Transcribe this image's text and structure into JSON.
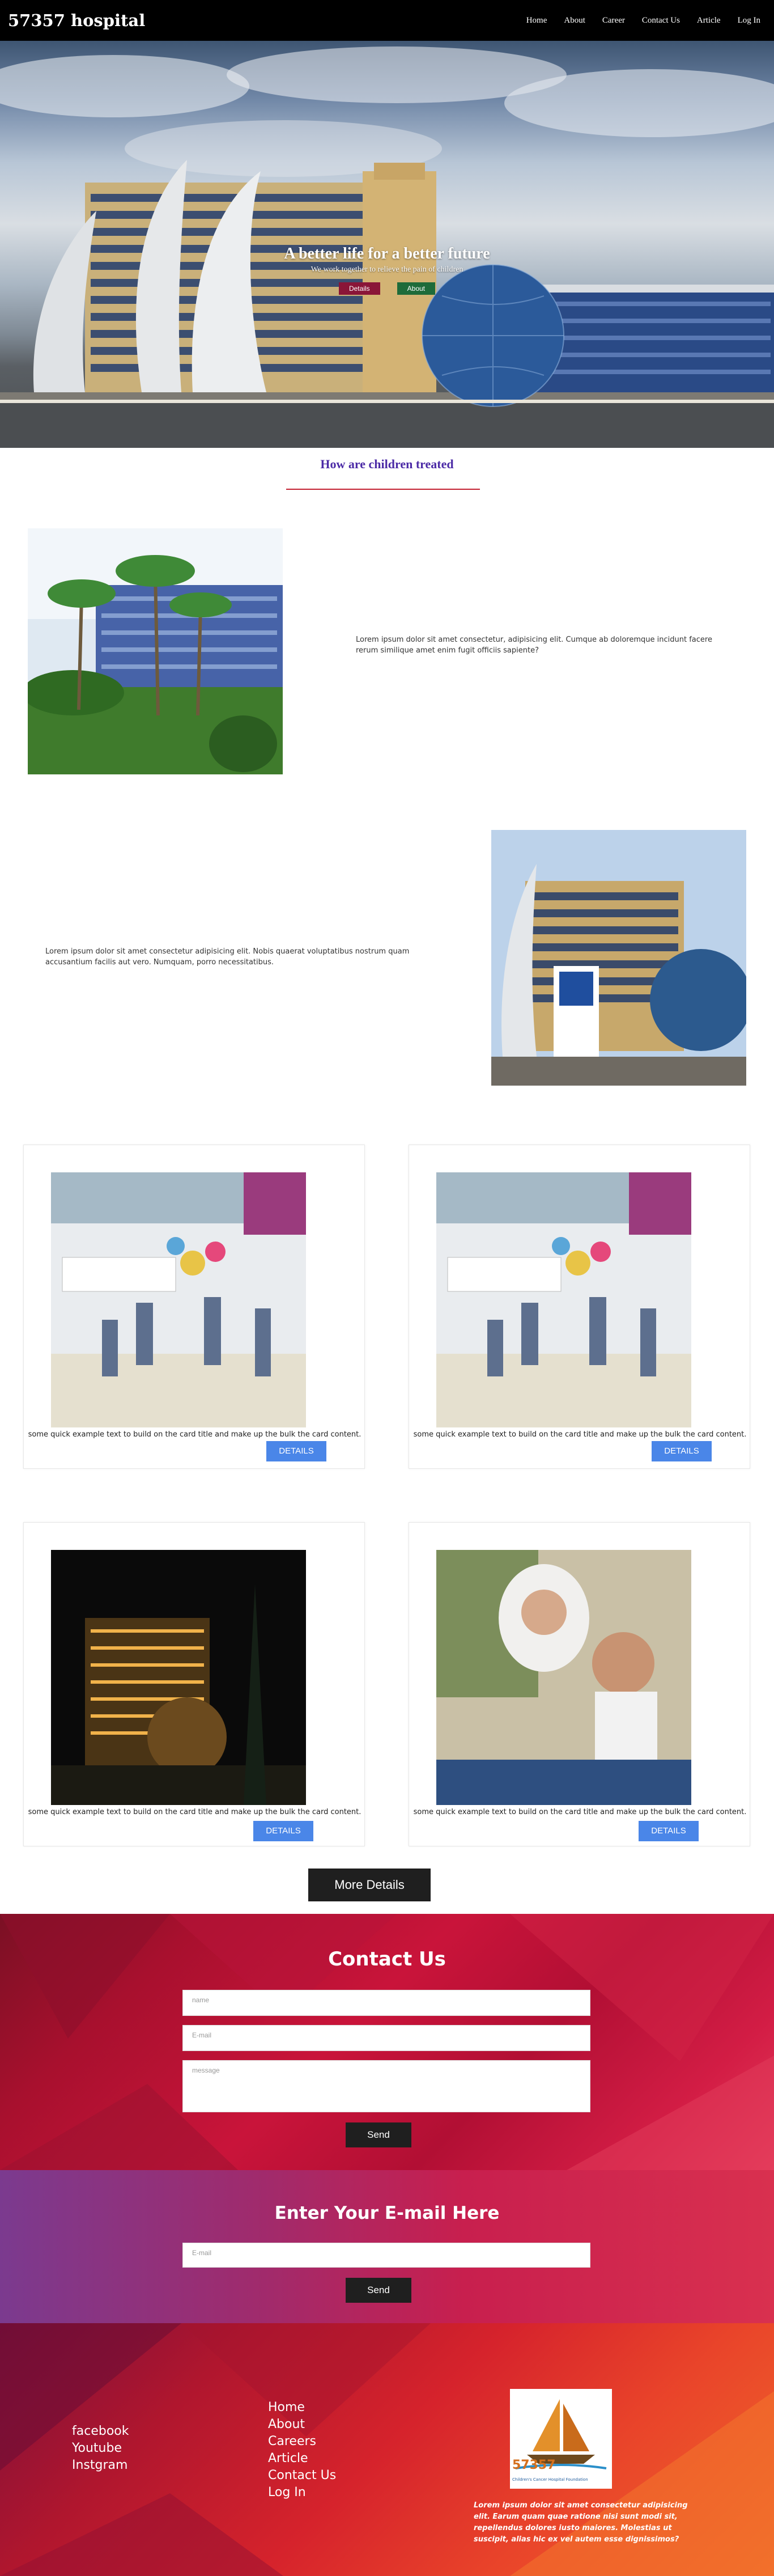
{
  "header": {
    "brand": "57357 hospital",
    "nav": [
      "Home",
      "About",
      "Career",
      "Contact Us",
      "Article",
      "Log In"
    ]
  },
  "hero": {
    "title": "A better life for a better future",
    "subtitle": "We work together to relieve the pain of children",
    "details_label": "Details",
    "about_label": "About"
  },
  "section": {
    "title": "How are children treated"
  },
  "features": [
    {
      "text": "Lorem ipsum dolor sit amet consectetur, adipisicing elit. Cumque ab doloremque incidunt facere rerum similique amet enim fugit officiis sapiente?"
    },
    {
      "text": "Lorem ipsum dolor sit amet consectetur adipisicing elit. Nobis quaerat voluptatibus nostrum quam accusantium facilis aut vero. Numquam, porro necessitatibus."
    }
  ],
  "cards": [
    {
      "text": "some quick example text to build on the card title and make up the bulk the card content.",
      "button": "DETAILS"
    },
    {
      "text": "some quick example text to build on the card title and make up the bulk the card content.",
      "button": "DETAILS"
    },
    {
      "text": "some quick example text to build on the card title and make up the bulk the card content.",
      "button": "DETAILS"
    },
    {
      "text": "some quick example text to build on the card title and make up the bulk the card content.",
      "button": "DETAILS"
    }
  ],
  "more_details_label": "More Details",
  "contact": {
    "title": "Contact Us",
    "name_placeholder": "name",
    "email_placeholder": "E-mail",
    "message_placeholder": "message",
    "send_label": "Send"
  },
  "subscribe": {
    "title": "Enter Your E-mail Here",
    "email_placeholder": "E-mail",
    "send_label": "Send"
  },
  "footer": {
    "social": [
      "facebook",
      "Youtube",
      "Instgram"
    ],
    "links": [
      "Home",
      "About",
      "Careers",
      "Article",
      "Contact Us",
      "Log In"
    ],
    "logo_number": "57357",
    "logo_caption": "Children's Cancer Hospital Foundation",
    "text": "Lorem ipsum dolor sit amet consectetur adipisicing elit. Earum quam quae ratione nisi sunt modi sit, repellendus dolores iusto maiores. Molestias ut suscipit, alias hic ex vel autem esse dignissimos?"
  }
}
